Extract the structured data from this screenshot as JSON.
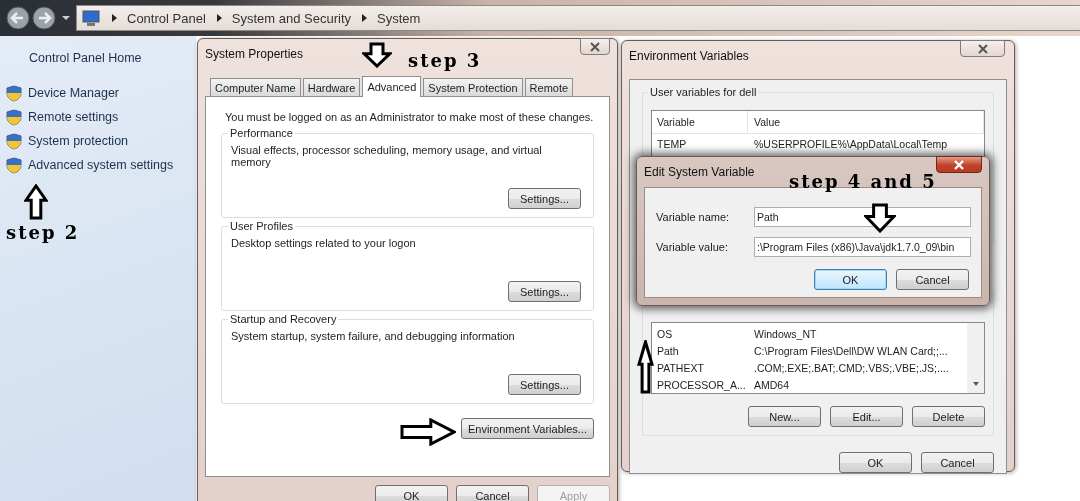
{
  "address_bar": {
    "breadcrumbs": [
      "Control Panel",
      "System and Security",
      "System"
    ]
  },
  "sidebar": {
    "home": "Control Panel Home",
    "items": [
      "Device Manager",
      "Remote settings",
      "System protection",
      "Advanced system settings"
    ]
  },
  "system_properties": {
    "title": "System Properties",
    "tabs": [
      {
        "label": "Computer Name",
        "selected": false
      },
      {
        "label": "Hardware",
        "selected": false
      },
      {
        "label": "Advanced",
        "selected": true
      },
      {
        "label": "System Protection",
        "selected": false
      },
      {
        "label": "Remote",
        "selected": false
      }
    ],
    "notice": "You must be logged on as an Administrator to make most of these changes.",
    "groups": [
      {
        "title": "Performance",
        "description": "Visual effects, processor scheduling, memory usage, and virtual memory",
        "button": "Settings..."
      },
      {
        "title": "User Profiles",
        "description": "Desktop settings related to your logon",
        "button": "Settings..."
      },
      {
        "title": "Startup and Recovery",
        "description": "System startup, system failure, and debugging information",
        "button": "Settings..."
      }
    ],
    "env_button": "Environment Variables...",
    "buttons": [
      {
        "label": "OK",
        "disabled": false
      },
      {
        "label": "Cancel",
        "disabled": false
      },
      {
        "label": "Apply",
        "disabled": true
      }
    ]
  },
  "environment_variables": {
    "title": "Environment Variables",
    "user_group": "User variables for dell",
    "user_columns": [
      "Variable",
      "Value"
    ],
    "user_rows": [
      [
        "TEMP",
        "%USERPROFILE%\\AppData\\Local\\Temp"
      ]
    ],
    "system_rows": [
      [
        "OS",
        "Windows_NT"
      ],
      [
        "Path",
        "C:\\Program Files\\Dell\\DW WLAN Card;;..."
      ],
      [
        "PATHEXT",
        ".COM;.EXE;.BAT;.CMD;.VBS;.VBE;.JS;...."
      ],
      [
        "PROCESSOR_A...",
        "AMD64"
      ]
    ],
    "list_buttons": [
      "New...",
      "Edit...",
      "Delete"
    ],
    "buttons": [
      "OK",
      "Cancel"
    ]
  },
  "edit_dialog": {
    "title": "Edit System Variable",
    "fields": [
      {
        "label": "Variable name:",
        "value": "Path"
      },
      {
        "label": "Variable value:",
        "value": ":\\Program Files (x86)\\Java\\jdk1.7.0_09\\bin"
      }
    ],
    "buttons": [
      {
        "label": "OK",
        "default": true
      },
      {
        "label": "Cancel",
        "default": false
      }
    ]
  },
  "annotations": [
    "step 2",
    "step 3",
    "step 4 and 5"
  ]
}
